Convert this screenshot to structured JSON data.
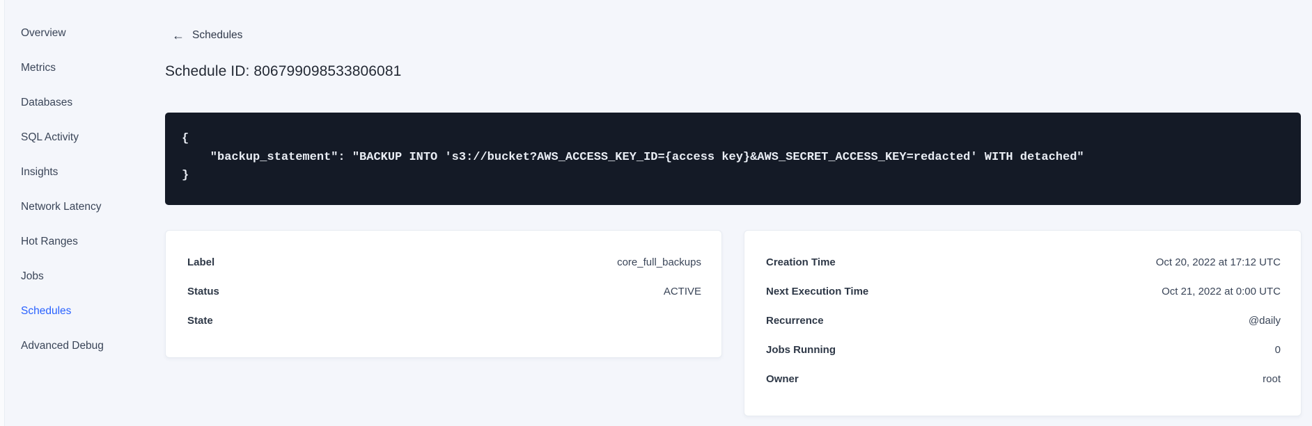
{
  "sidebar": {
    "active_item": "Schedules",
    "items": [
      {
        "label": "Overview"
      },
      {
        "label": "Metrics"
      },
      {
        "label": "Databases"
      },
      {
        "label": "SQL Activity"
      },
      {
        "label": "Insights"
      },
      {
        "label": "Network Latency"
      },
      {
        "label": "Hot Ranges"
      },
      {
        "label": "Jobs"
      },
      {
        "label": "Schedules"
      },
      {
        "label": "Advanced Debug"
      }
    ]
  },
  "header": {
    "back_icon": "←",
    "back_label": "Schedules",
    "title": "Schedule ID: 806799098533806081"
  },
  "code_block": {
    "lines": [
      "{",
      "    \"backup_statement\": \"BACKUP INTO 's3://bucket?AWS_ACCESS_KEY_ID={access key}&AWS_SECRET_ACCESS_KEY=redacted' WITH detached\"",
      "}"
    ]
  },
  "details_card": {
    "rows": [
      {
        "label": "Label",
        "value": "core_full_backups"
      },
      {
        "label": "Status",
        "value": "ACTIVE"
      },
      {
        "label": "State",
        "value": ""
      }
    ]
  },
  "schedule_card": {
    "rows": [
      {
        "label": "Creation Time",
        "value": "Oct 20, 2022 at 17:12 UTC"
      },
      {
        "label": "Next Execution Time",
        "value": "Oct 21, 2022 at 0:00 UTC"
      },
      {
        "label": "Recurrence",
        "value": "@daily"
      },
      {
        "label": "Jobs Running",
        "value": "0"
      },
      {
        "label": "Owner",
        "value": "root"
      }
    ]
  },
  "colors": {
    "accent_blue": "#2962FF",
    "page_background": "#F4F6FB",
    "code_background": "#141A26",
    "code_text": "#E9EDF4",
    "card_border": "#E8ECF2",
    "text_primary": "#242A35",
    "text_secondary": "#3A4558"
  }
}
